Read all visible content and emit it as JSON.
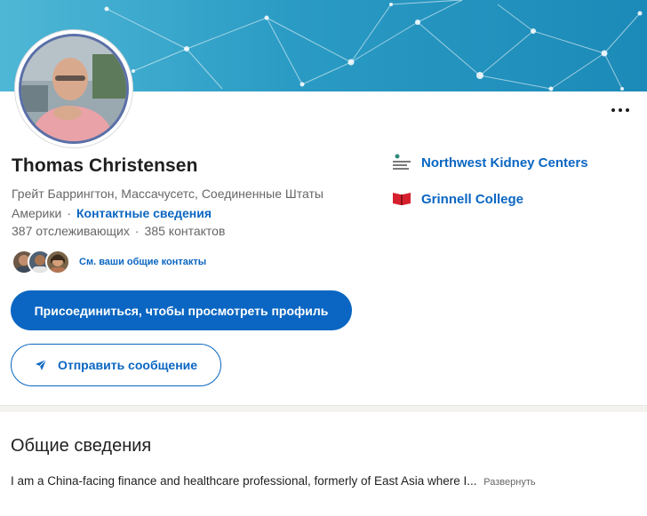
{
  "profile": {
    "name": "Thomas Christensen",
    "location": "Грейт Баррингтон, Массачусетс, Соединенные Штаты Америки",
    "contact_info": "Контактные сведения",
    "followers": "387 отслеживающих",
    "connections": "385 контактов",
    "mutual_link": "См. ваши общие контакты"
  },
  "actions": {
    "join": "Присоединиться, чтобы просмотреть профиль",
    "message": "Отправить сообщение"
  },
  "orgs": [
    {
      "name": "Northwest Kidney Centers",
      "icon": "kidney-centers-logo"
    },
    {
      "name": "Grinnell College",
      "icon": "grinnell-college-logo"
    }
  ],
  "about": {
    "title": "Общие сведения",
    "text": "I am a China-facing finance and healthcare professional, formerly of East Asia where I...",
    "expand": "Развернуть"
  },
  "colors": {
    "accent": "#0a66c2",
    "banner": "#2a9bc4",
    "muted": "#666666"
  }
}
